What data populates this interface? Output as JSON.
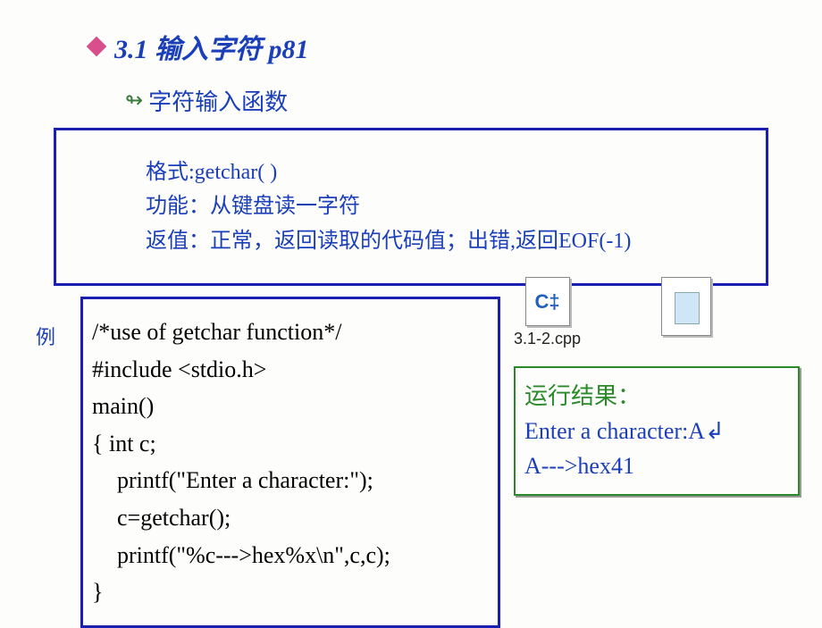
{
  "title": "3.1  输入字符 p81",
  "subtitle": "字符输入函数",
  "info": {
    "line1": "格式:getchar( )",
    "line2": "功能：从键盘读一字符",
    "line3": "返值：正常，返回读取的代码值；出错,返回EOF(-1)"
  },
  "example_label": "例",
  "code": {
    "l1": "/*use of getchar function*/",
    "l2": "#include <stdio.h>",
    "l3": "main()",
    "l4": "{  int c;",
    "l5": "printf(\"Enter a character:\");",
    "l6": "c=getchar();",
    "l7": "printf(\"%c--->hex%x\\n\",c,c);",
    "l8": "}"
  },
  "cpp_file": {
    "icon_text": "C‡",
    "name": "3.1-2.cpp"
  },
  "output": {
    "title": "运行结果：",
    "line1": "Enter a character:A",
    "return_symbol": "↲",
    "line2": "A--->hex41"
  }
}
